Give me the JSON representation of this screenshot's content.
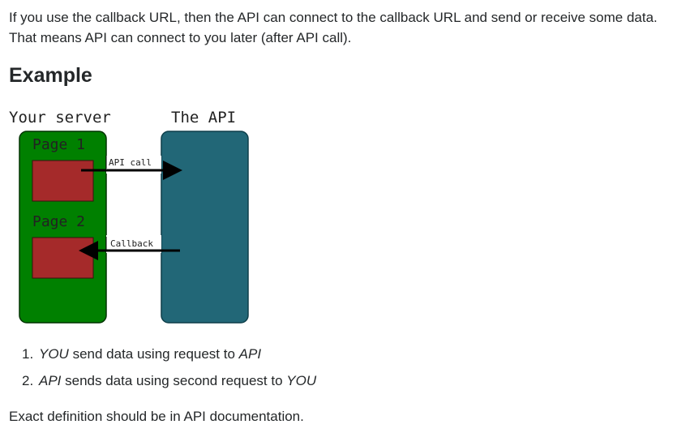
{
  "intro_text": "If you use the callback URL, then the API can connect to the callback URL and send or receive some data. That means API can connect to you later (after API call).",
  "heading": "Example",
  "diagram": {
    "server_label": "Your server",
    "api_label": "The API",
    "page1_label": "Page 1",
    "page2_label": "Page 2",
    "api_call_label": "API call",
    "callback_label": "Callback",
    "colors": {
      "server_box": "#008000",
      "api_box": "#226777",
      "page_block": "#a52a2a",
      "arrow": "#000000"
    }
  },
  "steps": [
    {
      "number": "1.",
      "actor": "YOU",
      "text": " send data using request to ",
      "target": "API"
    },
    {
      "number": "2.",
      "actor": "API",
      "text": " sends data using second request to ",
      "target": "YOU"
    }
  ],
  "outro_text": "Exact definition should be in API documentation."
}
